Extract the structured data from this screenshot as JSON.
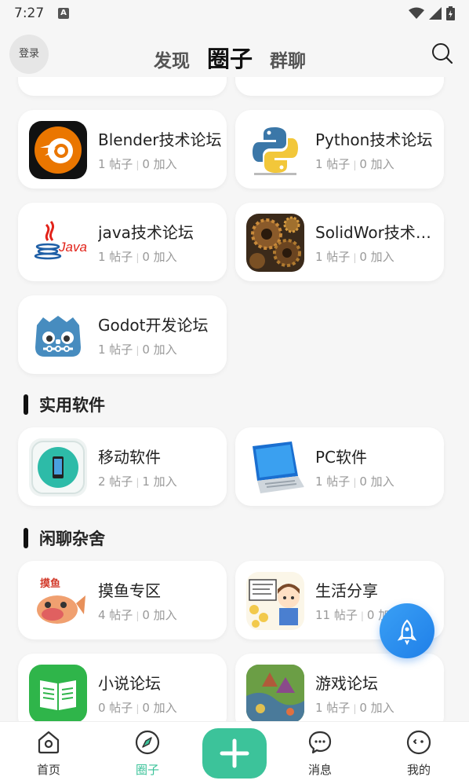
{
  "status": {
    "time": "7:27",
    "notif_letter": "A"
  },
  "header": {
    "login": "登录",
    "tabs": [
      "发现",
      "圈子",
      "群聊"
    ]
  },
  "forums": [
    {
      "name": "Blender技术论坛",
      "posts": "1 帖子",
      "joins": "0 加入",
      "icon": "blender-logo-icon"
    },
    {
      "name": "Python技术论坛",
      "posts": "1 帖子",
      "joins": "0 加入",
      "icon": "python-logo-icon"
    },
    {
      "name": "java技术论坛",
      "posts": "1 帖子",
      "joins": "0 加入",
      "icon": "java-logo-icon"
    },
    {
      "name": "SolidWor技术论坛",
      "posts": "1 帖子",
      "joins": "0 加入",
      "icon": "gears-icon"
    },
    {
      "name": "Godot开发论坛",
      "posts": "1 帖子",
      "joins": "0 加入",
      "icon": "godot-logo-icon"
    }
  ],
  "sections": {
    "software": {
      "title": "实用软件",
      "items": [
        {
          "name": "移动软件",
          "posts": "2 帖子",
          "joins": "1 加入",
          "icon": "phone-icon"
        },
        {
          "name": "PC软件",
          "posts": "1 帖子",
          "joins": "0 加入",
          "icon": "laptop-icon"
        }
      ]
    },
    "chat": {
      "title": "闲聊杂舍",
      "items": [
        {
          "name": "摸鱼专区",
          "posts": "4 帖子",
          "joins": "0 加入",
          "icon": "fish-cartoon-icon",
          "badge": "摸鱼"
        },
        {
          "name": "生活分享",
          "posts": "11 帖子",
          "joins": "0 加入",
          "icon": "cartoon-boy-icon"
        },
        {
          "name": "小说论坛",
          "posts": "0 帖子",
          "joins": "0 加入",
          "icon": "book-icon"
        },
        {
          "name": "游戏论坛",
          "posts": "1 帖子",
          "joins": "0 加入",
          "icon": "game-map-icon"
        }
      ]
    }
  },
  "bottom_nav": [
    {
      "label": "首页",
      "icon": "home-icon"
    },
    {
      "label": "圈子",
      "icon": "compass-icon",
      "active": true
    },
    {
      "label": "",
      "icon": "plus-icon"
    },
    {
      "label": "消息",
      "icon": "chat-bubble-icon"
    },
    {
      "label": "我的",
      "icon": "face-icon"
    }
  ],
  "colors": {
    "accent": "#3cc39a",
    "fab": "#2a8ff0",
    "background": "#f6f6f6"
  }
}
